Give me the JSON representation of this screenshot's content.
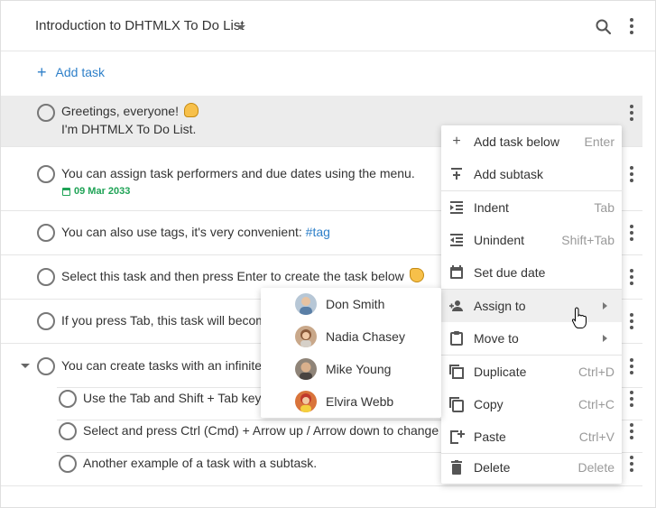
{
  "header": {
    "project_title": "Introduction to DHTMLX To Do List",
    "search_icon": "search-icon",
    "menu_icon": "more-vertical-icon"
  },
  "add_task": {
    "label": "Add task",
    "icon": "plus-icon"
  },
  "tasks": [
    {
      "line1": "Greetings, everyone!",
      "line2": "I'm DHTMLX To Do List.",
      "emoji": "waving-hand-emoji"
    },
    {
      "text": "You can assign task performers and due dates using the menu.",
      "due": "09 Mar 2033"
    },
    {
      "text": "You can also use tags, it's very convenient: ",
      "tag": "#tag"
    },
    {
      "text": "Select this task and then press Enter to create the task below",
      "emoji": "pointing-down-emoji"
    },
    {
      "text": "If you press Tab, this task will becom"
    },
    {
      "text": "You can create tasks with an infinite",
      "subtasks": [
        {
          "text": "Use the Tab and Shift + Tab keys"
        },
        {
          "text": "Select and press Ctrl (Cmd) + Arrow up / Arrow down to change"
        },
        {
          "text": "Another example of a task with a subtask."
        }
      ]
    }
  ],
  "context_menu": {
    "items": [
      {
        "label": "Add task below",
        "shortcut": "Enter",
        "icon": "plus-icon"
      },
      {
        "label": "Add subtask",
        "shortcut": "",
        "icon": "add-subtask-icon"
      },
      {
        "label": "Indent",
        "shortcut": "Tab",
        "icon": "indent-icon"
      },
      {
        "label": "Unindent",
        "shortcut": "Shift+Tab",
        "icon": "unindent-icon"
      },
      {
        "label": "Set due date",
        "shortcut": "",
        "icon": "calendar-icon"
      },
      {
        "label": "Assign to",
        "shortcut": "",
        "icon": "people-icon"
      },
      {
        "label": "Move to",
        "shortcut": "",
        "icon": "clipboard-icon"
      },
      {
        "label": "Duplicate",
        "shortcut": "Ctrl+D",
        "icon": "duplicate-icon"
      },
      {
        "label": "Copy",
        "shortcut": "Ctrl+C",
        "icon": "copy-icon"
      },
      {
        "label": "Paste",
        "shortcut": "Ctrl+V",
        "icon": "paste-icon"
      },
      {
        "label": "Delete",
        "shortcut": "Delete",
        "icon": "trash-icon"
      }
    ]
  },
  "assign_submenu": {
    "people": [
      {
        "name": "Don Smith",
        "color": "#b7c7d6"
      },
      {
        "name": "Nadia Chasey",
        "color": "#c9a88a"
      },
      {
        "name": "Mike Young",
        "color": "#8f8478"
      },
      {
        "name": "Elvira Webb",
        "color": "#d9743b"
      }
    ]
  },
  "colors": {
    "accent": "#2f80c9",
    "due": "#1fa356",
    "selected_row": "#ececec"
  }
}
